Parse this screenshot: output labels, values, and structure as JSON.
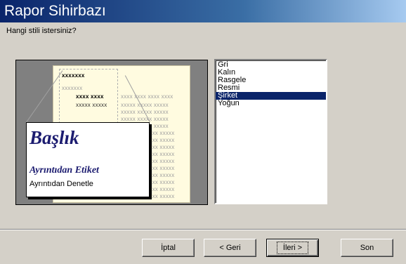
{
  "window": {
    "title": "Rapor Sihirbazı"
  },
  "header": {
    "question": "Hangi stili istersiniz?"
  },
  "preview": {
    "row_header": "xxxxxxx",
    "row_group": "xxxxxxx",
    "row_detail_bold": "xxxx xxxx",
    "row_detail_light": "xxxx xxxx  xxxx xxxx",
    "row_sub": "xxxxx xxxxx",
    "row_sub_light": "xxxxx xxxxx xxxxx",
    "zoom_title": "Başlık",
    "zoom_label": "Ayrıntıdan Etiket",
    "zoom_control": "Ayrıntıdan Denetle"
  },
  "styles": {
    "items": [
      "Gri",
      "Kalın",
      "Rasgele",
      "Resmi",
      "Şirket",
      "Yoğun"
    ],
    "selected_index": 4
  },
  "buttons": {
    "cancel": "İptal",
    "back": "< Geri",
    "next": "İleri >",
    "finish": "Son"
  },
  "colors": {
    "selection": "#0a246a",
    "title_accent": "#1c1c70"
  }
}
